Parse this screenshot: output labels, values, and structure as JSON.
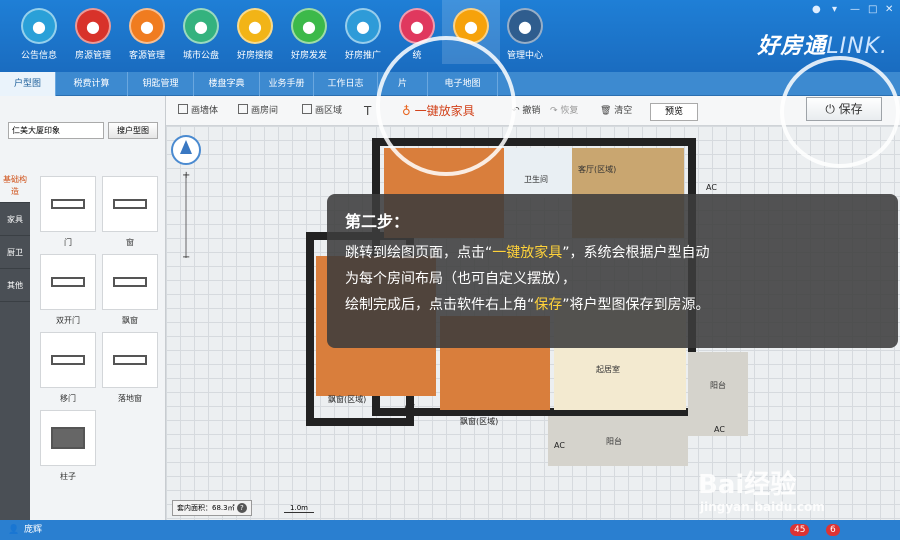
{
  "apps": [
    {
      "label": "公告信息",
      "color": "#2aa0d8",
      "icon": "chat-icon"
    },
    {
      "label": "房源管理",
      "color": "#d8322a",
      "icon": "house-icon"
    },
    {
      "label": "客源管理",
      "color": "#f07c20",
      "icon": "person-icon"
    },
    {
      "label": "城市公盘",
      "color": "#34b27e",
      "icon": "city-icon"
    },
    {
      "label": "好房搜搜",
      "color": "#f2b417",
      "icon": "search-icon"
    },
    {
      "label": "好房发发",
      "color": "#3cb94a",
      "icon": "publish-icon"
    },
    {
      "label": "好房推广",
      "color": "#2e9bd8",
      "icon": "rocket-icon"
    },
    {
      "label": "统",
      "color": "#e0385e",
      "icon": "pie-icon"
    },
    {
      "label": "",
      "color": "#f6a20b",
      "icon": "tools-icon"
    },
    {
      "label": "管理中心",
      "color": "#2f5d8e",
      "icon": "gear-icon"
    }
  ],
  "brand": {
    "main": "好房通",
    "sub": "LINK."
  },
  "tabs": [
    "户型图",
    "税费计算",
    "钥匙管理",
    "楼盘字典",
    "业务手册",
    "工作日志",
    "片",
    "电子地图"
  ],
  "toolbar": {
    "items": [
      "画墙体",
      "画房间",
      "画区域",
      "T",
      "一键放家具",
      "撤销",
      "恢复",
      "清空"
    ],
    "preview": "预览",
    "save": "保存"
  },
  "left": {
    "project": "仁美大厦印象",
    "search_btn": "搜户型图",
    "categories": [
      "基础构造",
      "家具",
      "厨卫",
      "其他"
    ],
    "items": [
      "门",
      "窗",
      "双开门",
      "飘窗",
      "移门",
      "落地窗",
      "柱子"
    ]
  },
  "canvas": {
    "rooms": [
      "卫生间",
      "客厅(区域)",
      "起居室",
      "阳台",
      "阳台",
      "飘窗(区域)",
      "飘窗(区域)",
      "AC",
      "AC",
      "AC",
      "AC"
    ],
    "area_label": "套内面积：68.3㎡",
    "scale": "1.0m"
  },
  "overlay": {
    "title": "第二步：",
    "line1_a": "跳转到绘图页面，点击“",
    "line1_hl": "一键放家具",
    "line1_b": "”，系统会根据户型自动",
    "line2": "为每个房间布局（也可自定义摆放），",
    "line3_a": "绘制完成后，点击软件右上角“",
    "line3_hl": "保存",
    "line3_b": "”将户型图保存到房源。"
  },
  "status": {
    "user": "庞辉",
    "badge1": "45",
    "badge2": "6"
  },
  "watermark": {
    "brand": "Bai经验",
    "url": "jingyan.baidu.com"
  }
}
